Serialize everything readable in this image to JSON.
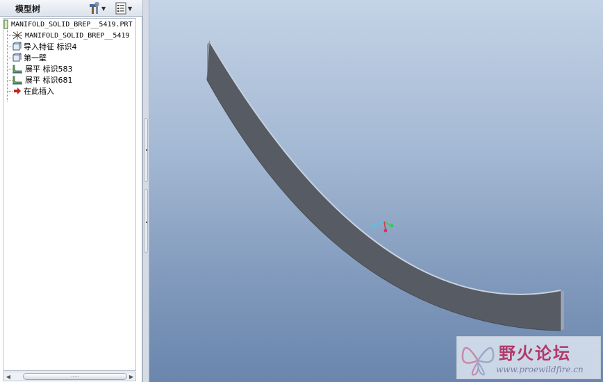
{
  "tree_panel": {
    "title": "模型树",
    "show_tools_icon": "hammer-wrench-icon",
    "settings_icon": "tree-settings-icon",
    "items": [
      {
        "label": "MANIFOLD_SOLID_BREP__5419.PRT",
        "icon": "part-icon"
      },
      {
        "label": "MANIFOLD_SOLID_BREP__5419",
        "icon": "coordinate-axes-icon"
      },
      {
        "label": "导入特征 标识4",
        "icon": "import-feature-icon"
      },
      {
        "label": "第一壁",
        "icon": "first-wall-icon"
      },
      {
        "label": "展平 标识583",
        "icon": "unbend-icon"
      },
      {
        "label": "展平 标识681",
        "icon": "unbend-icon"
      },
      {
        "label": "在此插入",
        "icon": "insert-here-arrow-icon"
      }
    ],
    "scrollbar_grip": "....."
  },
  "watermark": {
    "title": "野火论坛",
    "url": "www.proewildfire.cn"
  },
  "colors": {
    "model_face": "#5a5f66",
    "model_edge": "#c8d0dc",
    "insert_arrow": "#c0261c",
    "axis_x": "#e0334a",
    "axis_y": "#36c85a",
    "axis_z": "#4fc6e6"
  }
}
